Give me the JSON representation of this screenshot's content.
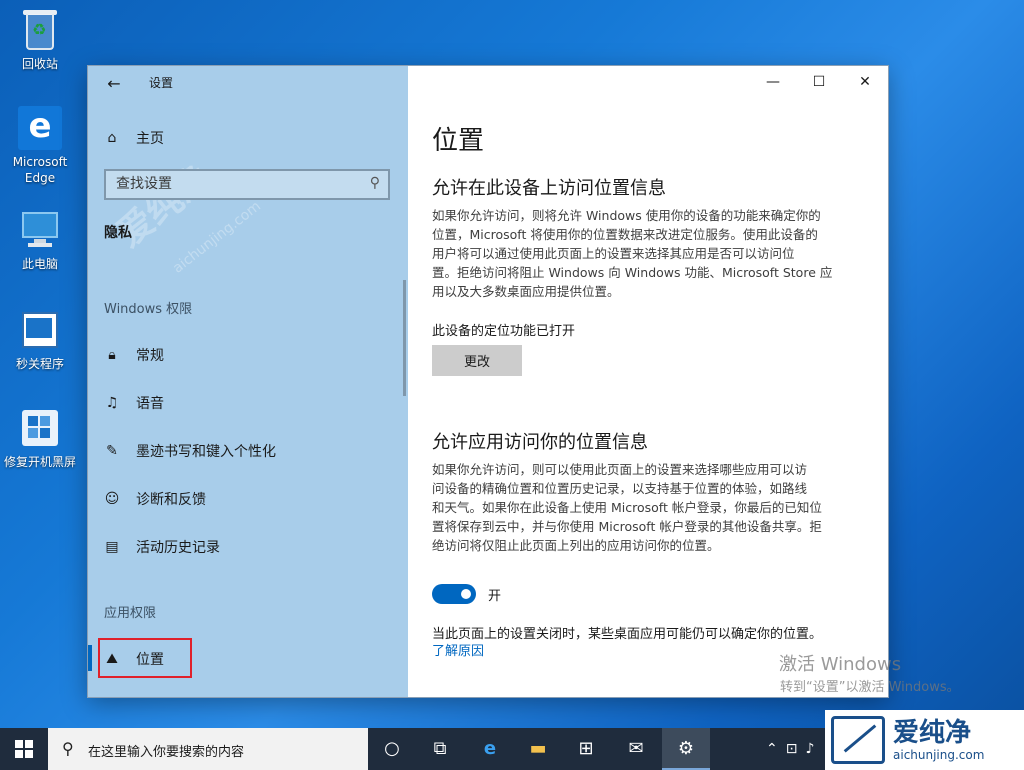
{
  "desktop": {
    "icons": [
      {
        "label": "回收站"
      },
      {
        "label": "Microsoft Edge"
      },
      {
        "label": "此电脑"
      },
      {
        "label": "秒关程序"
      },
      {
        "label": "修复开机黑屏"
      }
    ]
  },
  "window": {
    "title": "设置",
    "caption": {
      "minimize": "—",
      "maximize": "☐",
      "close": "✕"
    }
  },
  "sidebar": {
    "home_label": "主页",
    "search_placeholder": "查找设置",
    "section_title": "隐私",
    "windows_group": "Windows 权限",
    "windows_items": [
      {
        "label": "常规",
        "icon": "lock-icon"
      },
      {
        "label": "语音",
        "icon": "speech-icon"
      },
      {
        "label": "墨迹书写和键入个性化",
        "icon": "ink-icon"
      },
      {
        "label": "诊断和反馈",
        "icon": "feedback-icon"
      },
      {
        "label": "活动历史记录",
        "icon": "history-icon"
      }
    ],
    "app_group": "应用权限",
    "active_item": {
      "label": "位置",
      "icon": "location-icon"
    },
    "watermark": "爱纯净",
    "watermark_url": "aichunjing.com"
  },
  "content": {
    "page_title": "位置",
    "section1_title": "允许在此设备上访问位置信息",
    "section1_lines": [
      "如果你允许访问，则将允许 Windows 使用你的设备的功能来确定你的",
      "位置，Microsoft 将使用你的位置数据来改进定位服务。使用此设备的",
      "用户将可以通过使用此页面上的设置来选择其应用是否可以访问位",
      "置。拒绝访问将阻止 Windows 向 Windows 功能、Microsoft Store 应",
      "用以及大多数桌面应用提供位置。"
    ],
    "device_status": "此设备的定位功能已打开",
    "change_button": "更改",
    "section2_title": "允许应用访问你的位置信息",
    "section2_lines": [
      "如果你允许访问，则可以使用此页面上的设置来选择哪些应用可以访",
      "问设备的精确位置和位置历史记录，以支持基于位置的体验，如路线",
      "和天气。如果你在此设备上使用 Microsoft 帐户登录，你最后的已知位",
      "置将保存到云中，并与你使用 Microsoft 帐户登录的其他设备共享。拒",
      "绝访问将仅阻止此页面上列出的应用访问你的位置。"
    ],
    "toggle_state": "开",
    "note": "当此页面上的设置关闭时，某些桌面应用可能仍可以确定你的位置。",
    "link": "了解原因"
  },
  "activation": {
    "line1": "激活 Windows",
    "line2": "转到“设置”以激活 Windows。"
  },
  "corner_logo": {
    "name": "爱纯净",
    "url": "aichunjing.com"
  },
  "taskbar": {
    "search_placeholder": "在这里输入你要搜索的内容"
  },
  "colors": {
    "accent": "#0067c0",
    "sidebar_bg": "#a8cdea",
    "highlight_box": "#e0202a"
  }
}
